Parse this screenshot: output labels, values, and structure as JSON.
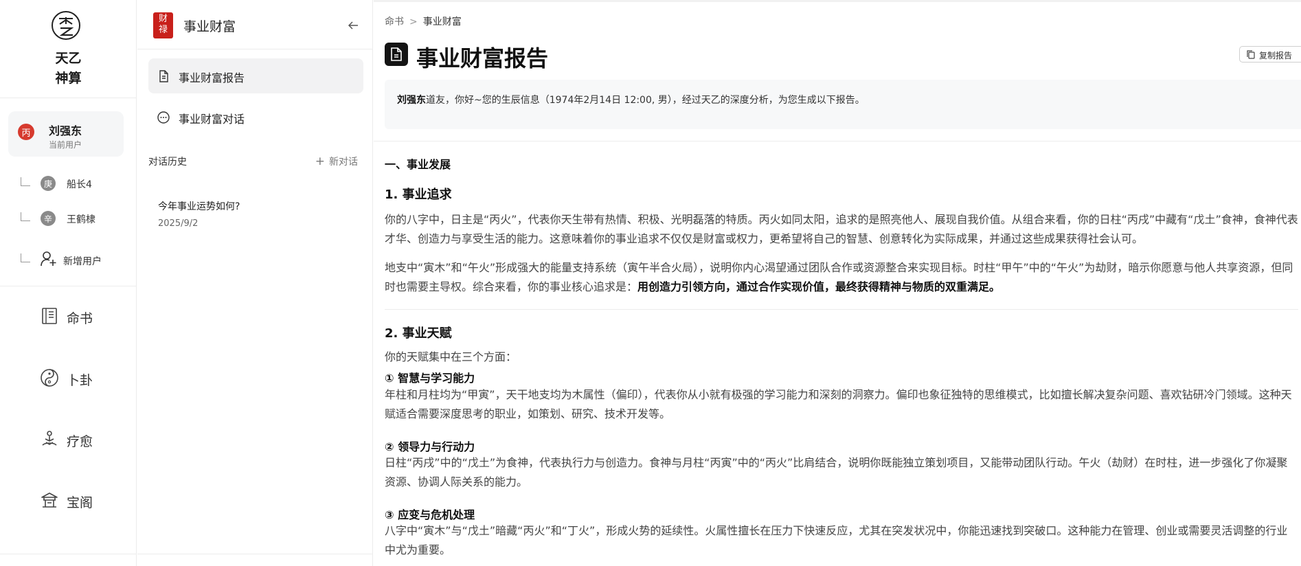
{
  "brand": {
    "line1": "天乙",
    "line2": "神算"
  },
  "current_user": {
    "avatar": "丙",
    "name": "刘强东",
    "role": "当前用户"
  },
  "sub_users": [
    {
      "avatar": "庚",
      "name": "船长4"
    },
    {
      "avatar": "辛",
      "name": "王鹤棣"
    }
  ],
  "add_user_label": "新增用户",
  "nav": [
    {
      "label": "命书",
      "icon": "book-icon"
    },
    {
      "label": "卜卦",
      "icon": "yinyang-icon"
    },
    {
      "label": "疗愈",
      "icon": "meditation-icon"
    },
    {
      "label": "宝阁",
      "icon": "pavilion-icon"
    }
  ],
  "mid": {
    "seal_l1": "财",
    "seal_l2": "禄",
    "title": "事业财富",
    "items": [
      {
        "label": "事业财富报告",
        "icon": "document-icon",
        "active": true
      },
      {
        "label": "事业财富对话",
        "icon": "chat-icon",
        "active": false
      }
    ],
    "history_title": "对话历史",
    "new_chat": "新对话",
    "history": [
      {
        "title": "今年事业运势如何?",
        "date": "2025/9/2"
      }
    ]
  },
  "main": {
    "breadcrumb": [
      "命书",
      "事业财富"
    ],
    "title": "事业财富报告",
    "copy_label": "复制报告",
    "greeting_name": "刘强东",
    "greeting_rest": "道友，你好~您的生辰信息（1974年2月14日 12:00, 男），经过天乙的深度分析，为您生成以下报告。",
    "section1": "一、事业发展",
    "sub1": "1. 事业追求",
    "p1": "你的八字中，日主是“丙火”，代表你天生带有热情、积极、光明磊落的特质。丙火如同太阳，追求的是照亮他人、展现自我价值。从组合来看，你的日柱“丙戌”中藏有“戊土”食神，食神代表才华、创造力与享受生活的能力。这意味着你的事业追求不仅仅是财富或权力，更希望将自己的智慧、创意转化为实际成果，并通过这些成果获得社会认可。",
    "p2a": "地支中“寅木”和“午火”形成强大的能量支持系统（寅午半合火局），说明你内心渴望通过团队合作或资源整合来实现目标。时柱“甲午”中的“午火”为劫财，暗示你愿意与他人共享资源，但同时也需要主导权。综合来看，你的事业核心追求是：",
    "p2b": "用创造力引领方向，通过合作实现价值，最终获得精神与物质的双重满足。",
    "sub2": "2. 事业天赋",
    "p3": "你的天赋集中在三个方面：",
    "pt1": "① 智慧与学习能力",
    "pt1_text": "年柱和月柱均为“甲寅”，天干地支均为木属性（偏印），代表你从小就有极强的学习能力和深刻的洞察力。偏印也象征独特的思维模式，比如擅长解决复杂问题、喜欢钻研冷门领域。这种天赋适合需要深度思考的职业，如策划、研究、技术开发等。",
    "pt2": "② 领导力与行动力",
    "pt2_text": "日柱“丙戌”中的“戊土”为食神，代表执行力与创造力。食神与月柱“丙寅”中的“丙火”比肩结合，说明你既能独立策划项目，又能带动团队行动。午火（劫财）在时柱，进一步强化了你凝聚资源、协调人际关系的能力。",
    "pt3": "③ 应变与危机处理",
    "pt3_text": "八字中“寅木”与“戊土”暗藏“丙火”和“丁火”，形成火势的延续性。火属性擅长在压力下快速反应，尤其在突发状况中，你能迅速找到突破口。这种能力在管理、创业或需要灵活调整的行业中尤为重要。"
  }
}
